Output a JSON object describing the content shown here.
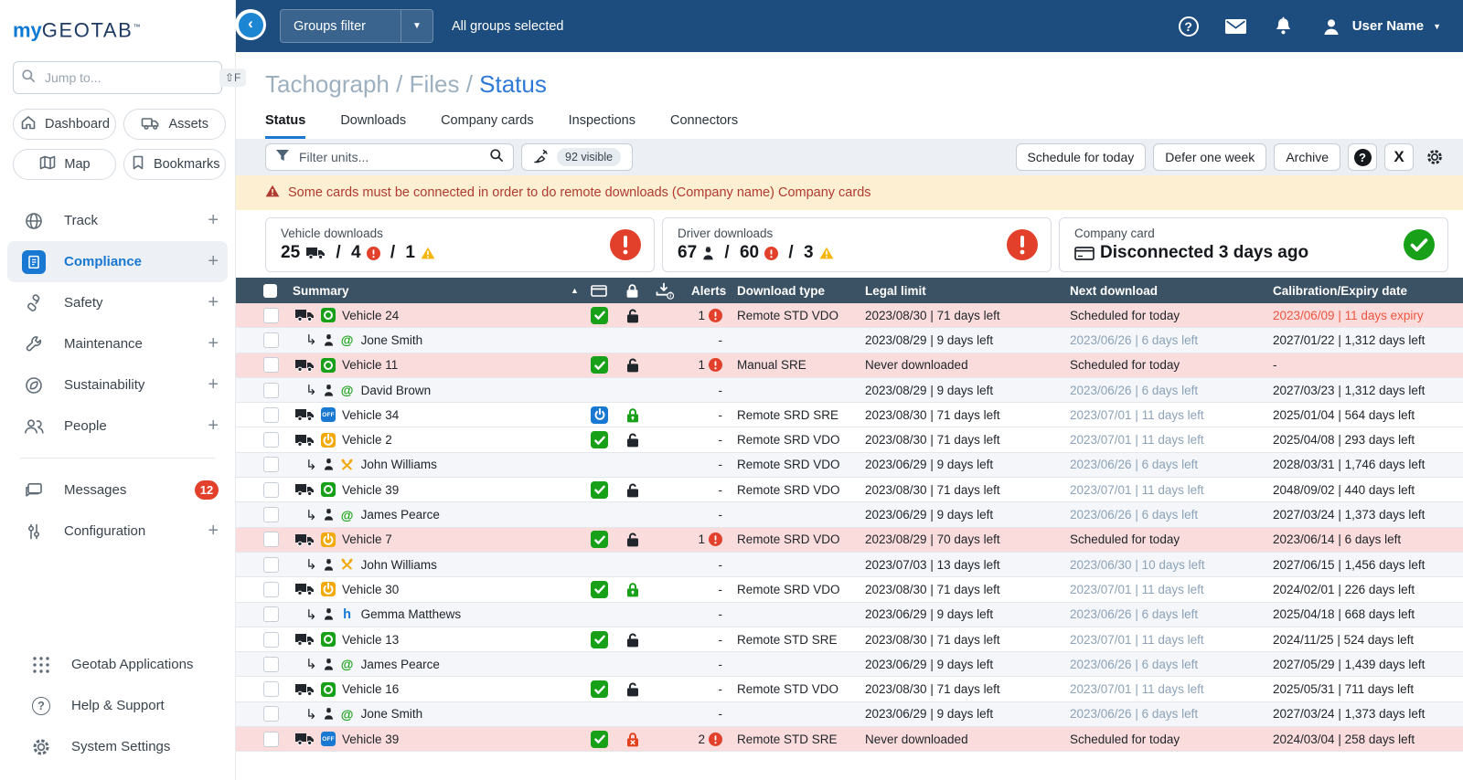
{
  "sidebar": {
    "logo": {
      "my": "my",
      "geotab": "GEOTAB",
      "tm": "TM"
    },
    "search": {
      "placeholder": "Jump to...",
      "shortcut": "⇧F"
    },
    "quick_buttons": [
      {
        "label": "Dashboard",
        "icon": "home-icon"
      },
      {
        "label": "Assets",
        "icon": "truck-outline-icon"
      },
      {
        "label": "Map",
        "icon": "map-icon"
      },
      {
        "label": "Bookmarks",
        "icon": "bookmark-icon"
      }
    ],
    "nav": [
      {
        "label": "Track",
        "icon": "globe-icon",
        "expandable": true,
        "active": false
      },
      {
        "label": "Compliance",
        "icon": "compliance-icon",
        "expandable": true,
        "active": true
      },
      {
        "label": "Safety",
        "icon": "safety-belt-icon",
        "expandable": true,
        "active": false
      },
      {
        "label": "Maintenance",
        "icon": "wrench-icon",
        "expandable": true,
        "active": false
      },
      {
        "label": "Sustainability",
        "icon": "leaf-icon",
        "expandable": true,
        "active": false
      },
      {
        "label": "People",
        "icon": "people-icon",
        "expandable": true,
        "active": false
      }
    ],
    "secondary_nav": [
      {
        "label": "Messages",
        "icon": "messages-icon",
        "badge": "12"
      },
      {
        "label": "Configuration",
        "icon": "sliders-icon",
        "expandable": true
      }
    ],
    "footer_nav": [
      {
        "label": "Geotab Applications",
        "icon": "apps-grid-icon"
      },
      {
        "label": "Help & Support",
        "icon": "help-icon"
      },
      {
        "label": "System Settings",
        "icon": "gear-icon"
      }
    ]
  },
  "topbar": {
    "groups_filter_label": "Groups filter",
    "groups_selected": "All groups selected",
    "icons": [
      "help-icon",
      "mail-icon",
      "notifications-icon",
      "user-icon"
    ],
    "user_name": "User Name"
  },
  "page": {
    "breadcrumb": {
      "parts": [
        "Tachograph",
        "Files"
      ],
      "separator": " / ",
      "current": "Status"
    },
    "tabs": [
      {
        "label": "Status",
        "active": true
      },
      {
        "label": "Downloads",
        "active": false
      },
      {
        "label": "Company cards",
        "active": false
      },
      {
        "label": "Inspections",
        "active": false
      },
      {
        "label": "Connectors",
        "active": false
      }
    ],
    "toolbar": {
      "filter_placeholder": "Filter units...",
      "visible_count": "92 visible",
      "buttons": [
        "Schedule for today",
        "Defer one week",
        "Archive"
      ],
      "icon_buttons": [
        "help-circle-button",
        "export-x-button",
        "settings-gear-button"
      ]
    },
    "warning_banner": "Some cards must be connected in order to do remote downloads (Company name) Company cards",
    "summary_cards": [
      {
        "title": "Vehicle downloads",
        "separator": "/",
        "parts": [
          {
            "text": "25",
            "icon": "truck-icon"
          },
          {
            "text": "4",
            "icon": "alert-red-icon"
          },
          {
            "text": "1",
            "icon": "warning-yellow-icon"
          }
        ],
        "status": "error"
      },
      {
        "title": "Driver downloads",
        "separator": "/",
        "parts": [
          {
            "text": "67",
            "icon": "driver-icon"
          },
          {
            "text": "60",
            "icon": "alert-red-icon"
          },
          {
            "text": "3",
            "icon": "warning-yellow-icon"
          }
        ],
        "status": "error"
      },
      {
        "title": "Company card",
        "icon": "company-card-icon",
        "text": "Disconnected 3 days ago",
        "status": "ok"
      }
    ],
    "table": {
      "headers": {
        "summary": "Summary",
        "alerts": "Alerts",
        "download_type": "Download type",
        "legal_limit": "Legal limit",
        "next_download": "Next download",
        "calibration": "Calibration/Expiry date"
      },
      "header_icons": [
        "sort-asc-icon",
        "company-card-icon",
        "lock-icon",
        "download-info-icon"
      ],
      "rows": [
        {
          "kind": "vehicle",
          "flag": true,
          "name": "Vehicle 24",
          "badge": "tacho-green",
          "card": "check-green",
          "lock": "open-black",
          "alerts": "1",
          "download_type": "Remote STD VDO",
          "legal_limit": "2023/08/30 | 71 days left",
          "next_download": "Scheduled for today",
          "next_muted": false,
          "calibration": "2023/06/09 | 11 days expiry",
          "calibration_alert": true
        },
        {
          "kind": "driver",
          "flag": false,
          "name": "Jone Smith",
          "badge": "at-green",
          "card": "",
          "lock": "",
          "alerts": "-",
          "download_type": "",
          "legal_limit": "2023/08/29 | 9 days left",
          "next_download": "2023/06/26 | 6 days left",
          "next_muted": true,
          "calibration": "2027/01/22 | 1,312 days left",
          "calibration_alert": false
        },
        {
          "kind": "vehicle",
          "flag": true,
          "name": "Vehicle 11",
          "badge": "tacho-green",
          "card": "check-green",
          "lock": "open-black",
          "alerts": "1",
          "download_type": "Manual SRE",
          "legal_limit": "Never downloaded",
          "next_download": "Scheduled for today",
          "next_muted": false,
          "calibration": "-",
          "calibration_alert": false
        },
        {
          "kind": "driver",
          "flag": false,
          "name": "David Brown",
          "badge": "at-green",
          "card": "",
          "lock": "",
          "alerts": "-",
          "download_type": "",
          "legal_limit": "2023/08/29 | 9 days left",
          "next_download": "2023/06/26 | 6 days left",
          "next_muted": true,
          "calibration": "2027/03/23 | 1,312 days left",
          "calibration_alert": false
        },
        {
          "kind": "vehicle",
          "flag": false,
          "name": "Vehicle 34",
          "badge": "off-blue",
          "card": "power-blue",
          "lock": "closed-green",
          "alerts": "-",
          "download_type": "Remote SRD SRE",
          "legal_limit": "2023/08/30 | 71 days left",
          "next_download": "2023/07/01 | 11 days left",
          "next_muted": true,
          "calibration": "2025/01/04 | 564 days left",
          "calibration_alert": false
        },
        {
          "kind": "vehicle",
          "flag": false,
          "name": "Vehicle 2",
          "badge": "power-yellow",
          "card": "check-green",
          "lock": "open-black",
          "alerts": "-",
          "download_type": "Remote SRD VDO",
          "legal_limit": "2023/08/30 | 71 days left",
          "next_download": "2023/07/01 | 11 days left",
          "next_muted": true,
          "calibration": "2025/04/08 | 293 days left",
          "calibration_alert": false
        },
        {
          "kind": "driver",
          "flag": false,
          "name": "John Williams",
          "badge": "tools-yellow",
          "card": "",
          "lock": "",
          "alerts": "-",
          "download_type": "Remote SRD VDO",
          "legal_limit": "2023/06/29 | 9 days left",
          "next_download": "2023/06/26 | 6 days left",
          "next_muted": true,
          "calibration": "2028/03/31 | 1,746 days left",
          "calibration_alert": false
        },
        {
          "kind": "vehicle",
          "flag": false,
          "name": "Vehicle 39",
          "badge": "tacho-green",
          "card": "check-green",
          "lock": "open-black",
          "alerts": "-",
          "download_type": "Remote SRD VDO",
          "legal_limit": "2023/08/30 | 71 days left",
          "next_download": "2023/07/01 | 11 days left",
          "next_muted": true,
          "calibration": "2048/09/02 | 440 days left",
          "calibration_alert": false
        },
        {
          "kind": "driver",
          "flag": false,
          "name": "James Pearce",
          "badge": "at-green",
          "card": "",
          "lock": "",
          "alerts": "-",
          "download_type": "",
          "legal_limit": "2023/06/29 | 9 days left",
          "next_download": "2023/06/26 | 6 days left",
          "next_muted": true,
          "calibration": "2027/03/24 | 1,373 days left",
          "calibration_alert": false
        },
        {
          "kind": "vehicle",
          "flag": true,
          "name": "Vehicle 7",
          "badge": "power-yellow",
          "card": "check-green",
          "lock": "open-black",
          "alerts": "1",
          "download_type": "Remote SRD VDO",
          "legal_limit": "2023/08/29 | 70 days left",
          "next_download": "Scheduled for today",
          "next_muted": false,
          "calibration": "2023/06/14 | 6 days left",
          "calibration_alert": false
        },
        {
          "kind": "driver",
          "flag": false,
          "name": "John Williams",
          "badge": "tools-yellow",
          "card": "",
          "lock": "",
          "alerts": "-",
          "download_type": "",
          "legal_limit": "2023/07/03 | 13 days left",
          "next_download": "2023/06/30 | 10 days left",
          "next_muted": true,
          "calibration": "2027/06/15 | 1,456 days left",
          "calibration_alert": false
        },
        {
          "kind": "vehicle",
          "flag": false,
          "name": "Vehicle 30",
          "badge": "power-yellow",
          "card": "check-green",
          "lock": "closed-green",
          "alerts": "-",
          "download_type": "Remote SRD VDO",
          "legal_limit": "2023/08/30 | 71 days left",
          "next_download": "2023/07/01 | 11 days left",
          "next_muted": true,
          "calibration": "2024/02/01 | 226 days left",
          "calibration_alert": false
        },
        {
          "kind": "driver",
          "flag": false,
          "name": "Gemma Matthews",
          "badge": "rest-blue",
          "card": "",
          "lock": "",
          "alerts": "-",
          "download_type": "",
          "legal_limit": "2023/06/29 | 9 days left",
          "next_download": "2023/06/26 | 6 days left",
          "next_muted": true,
          "calibration": "2025/04/18 | 668 days left",
          "calibration_alert": false
        },
        {
          "kind": "vehicle",
          "flag": false,
          "name": "Vehicle 13",
          "badge": "tacho-green",
          "card": "check-green",
          "lock": "open-black",
          "alerts": "-",
          "download_type": "Remote STD SRE",
          "legal_limit": "2023/08/30 | 71 days left",
          "next_download": "2023/07/01 | 11 days left",
          "next_muted": true,
          "calibration": "2024/11/25 | 524 days left",
          "calibration_alert": false
        },
        {
          "kind": "driver",
          "flag": false,
          "name": "James Pearce",
          "badge": "at-green",
          "card": "",
          "lock": "",
          "alerts": "-",
          "download_type": "",
          "legal_limit": "2023/06/29 | 9 days left",
          "next_download": "2023/06/26 | 6 days left",
          "next_muted": true,
          "calibration": "2027/05/29 | 1,439 days left",
          "calibration_alert": false
        },
        {
          "kind": "vehicle",
          "flag": false,
          "name": "Vehicle 16",
          "badge": "tacho-green",
          "card": "check-green",
          "lock": "open-black",
          "alerts": "-",
          "download_type": "Remote STD VDO",
          "legal_limit": "2023/08/30 | 71 days left",
          "next_download": "2023/07/01 | 11 days left",
          "next_muted": true,
          "calibration": "2025/05/31 | 711 days left",
          "calibration_alert": false
        },
        {
          "kind": "driver",
          "flag": false,
          "name": "Jone Smith",
          "badge": "at-green",
          "card": "",
          "lock": "",
          "alerts": "-",
          "download_type": "",
          "legal_limit": "2023/06/29 | 9 days left",
          "next_download": "2023/06/26 | 6 days left",
          "next_muted": true,
          "calibration": "2027/03/24 | 1,373 days left",
          "calibration_alert": false
        },
        {
          "kind": "vehicle",
          "flag": true,
          "name": "Vehicle 39",
          "badge": "off-blue",
          "card": "check-green",
          "lock": "error-red",
          "alerts": "2",
          "download_type": "Remote STD SRE",
          "legal_limit": "Never downloaded",
          "next_download": "Scheduled for today",
          "next_muted": false,
          "calibration": "2024/03/04 | 258 days left",
          "calibration_alert": false
        }
      ]
    }
  },
  "colors": {
    "topbar_bg": "#1d4d7e",
    "accent_blue": "#1878d2",
    "breadcrumb_link": "#2f7ad6",
    "success_green": "#18a018",
    "error_red": "#e2402a",
    "warning_yellow": "#f2a90a",
    "banner_bg": "#fcefd2",
    "banner_text": "#b13a30",
    "flagged_row_bg": "#fadcdc",
    "driver_row_bg": "#f4f6f9",
    "table_header_bg": "#3b5164",
    "muted_date": "#8ca2b8",
    "expiry_red": "#ee5540",
    "badge_red": "#e2402a"
  }
}
